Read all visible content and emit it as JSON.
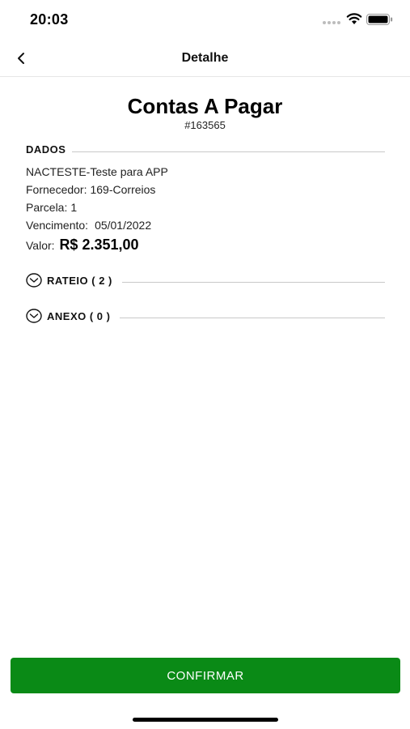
{
  "status_bar": {
    "time": "20:03"
  },
  "nav": {
    "title": "Detalhe",
    "back_icon": "chevron-left-icon"
  },
  "header": {
    "title": "Contas A Pagar",
    "id": "#163565"
  },
  "dados": {
    "label": "DADOS",
    "description": "NACTESTE-Teste para APP",
    "fornecedor_label": "Fornecedor:",
    "fornecedor_value": "169-Correios",
    "parcela_label": "Parcela:",
    "parcela_value": "1",
    "vencimento_label": "Vencimento:",
    "vencimento_value": "05/01/2022",
    "valor_label": "Valor:",
    "valor_value": "R$ 2.351,00"
  },
  "sections": {
    "rateio": {
      "label": "RATEIO ( 2 )",
      "icon": "chevron-down-circle-icon"
    },
    "anexo": {
      "label": "ANEXO ( 0 )",
      "icon": "chevron-down-circle-icon"
    }
  },
  "footer": {
    "confirm_label": "CONFIRMAR"
  },
  "colors": {
    "accent": "#0a8a16",
    "divider": "#c8c8c8"
  }
}
